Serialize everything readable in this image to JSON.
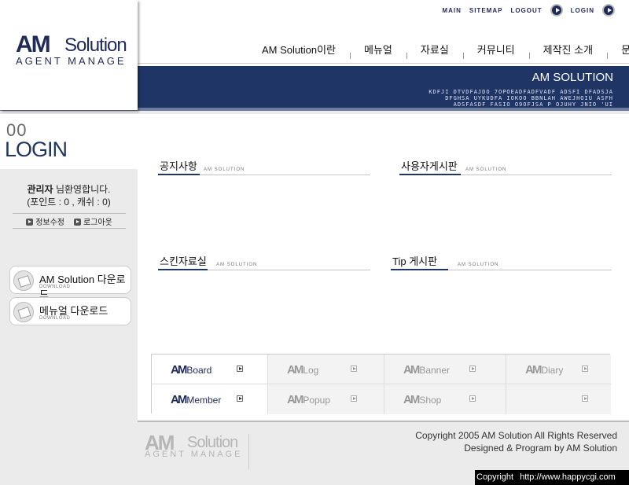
{
  "logo": {
    "am": "AM",
    "solution": "Solution",
    "agent": "AGENT MANAGE"
  },
  "top_links": {
    "main": "MAIN",
    "sitemap": "SITEMAP",
    "logout": "LOGOUT",
    "login": "LOGIN"
  },
  "main_nav": [
    "AM Solution이란",
    "메뉴얼",
    "자료실",
    "커뮤니티",
    "제작진 소개",
    "문의하기"
  ],
  "banner": {
    "title": "AM SOLUTION",
    "lines": [
      "KDFJI DTVDFAJDO 7OPOEADFADFVADF ADSFI DFADSJA",
      "DFGHSA UYKUDFA IOKOO BBNLAH AWEJHOIU ASFH",
      "ADSFASDF FASIO O9OFJSA P OJUHY JNIO 'UI"
    ]
  },
  "login": {
    "counter": "00",
    "title": "LOGIN"
  },
  "user": {
    "role": "관리자",
    "greeting": "님환영합니다.",
    "points": "(포인트 : 0 , 캐쉬 : 0)",
    "edit_info": "정보수정",
    "logout": "로그아웃"
  },
  "downloads": [
    {
      "title": "AM Solution 다운로드",
      "sub": "DOWNLOAD"
    },
    {
      "title": "메뉴얼 다운로드",
      "sub": "DOWNLOAD"
    }
  ],
  "boards": [
    {
      "title": "공지사항",
      "sub": "AM SOLUTION"
    },
    {
      "title": "사용자게시판",
      "sub": "AM SOLUTION"
    },
    {
      "title": "스킨자료실",
      "sub": "AM SOLUTION"
    },
    {
      "title": "Tip 게시판",
      "sub": "AM SOLUTION"
    }
  ],
  "products": [
    {
      "am": "AM",
      "name": "Board"
    },
    {
      "am": "AM",
      "name": "Log"
    },
    {
      "am": "AM",
      "name": "Banner"
    },
    {
      "am": "AM",
      "name": "Diary"
    },
    {
      "am": "AM",
      "name": "Member"
    },
    {
      "am": "AM",
      "name": "Popup"
    },
    {
      "am": "AM",
      "name": "Shop"
    },
    {
      "am": "",
      "name": ""
    }
  ],
  "footer": {
    "am": "AM",
    "solution": "Solution",
    "agent": "AGENT MANAGE",
    "copyright": "Copyright 2005 AM Solution All Rights Reserved",
    "designed": "Designed & Program by AM Solution"
  },
  "corner": {
    "label": "Copyright",
    "url": "http://www.happycgi.com"
  }
}
